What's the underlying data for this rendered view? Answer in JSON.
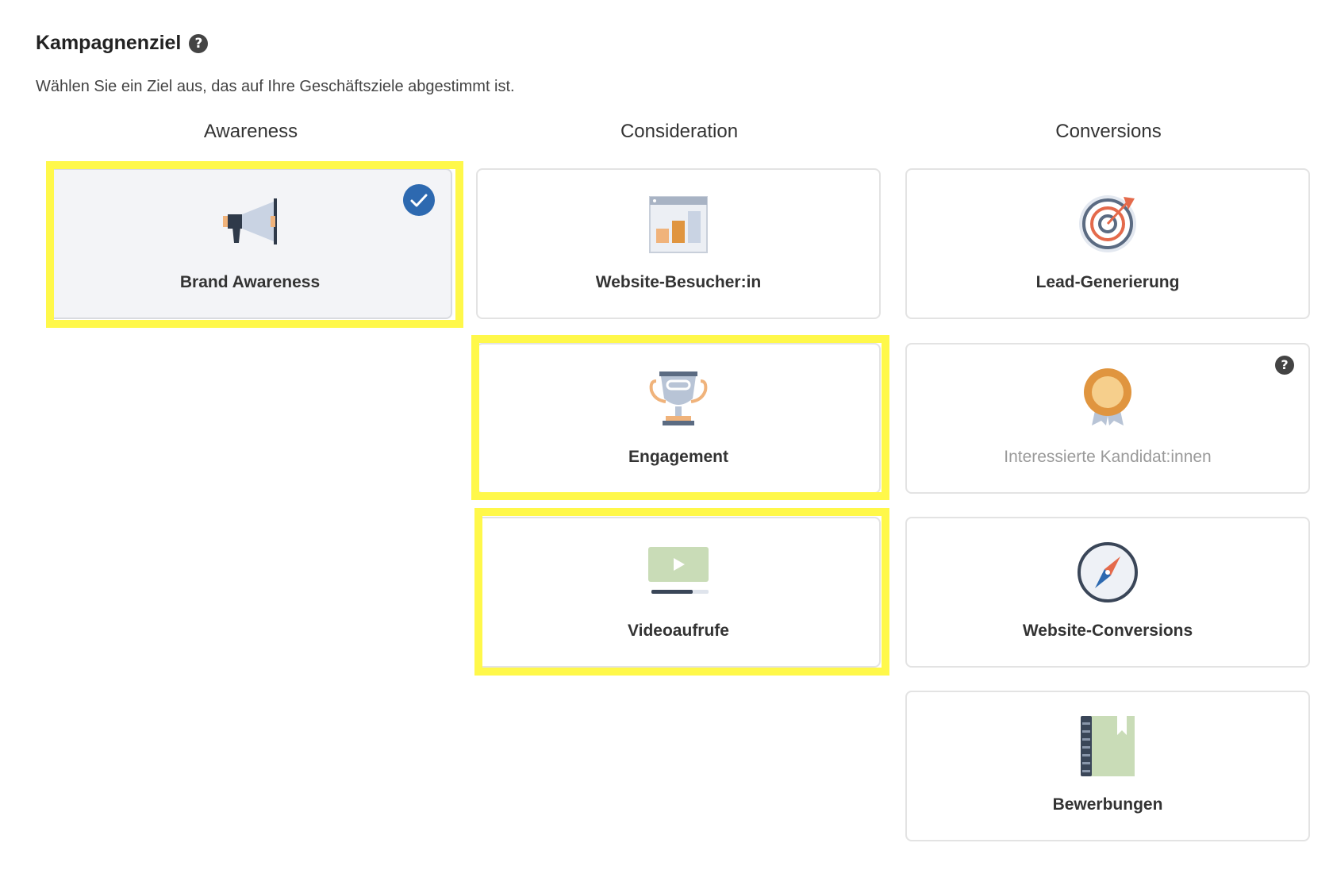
{
  "header": {
    "title": "Kampagnenziel",
    "title_help_icon": "question-circle-icon",
    "subtitle": "Wählen Sie ein Ziel aus, das auf Ihre Geschäftsziele abgestimmt ist."
  },
  "columns": {
    "awareness": "Awareness",
    "consideration": "Consideration",
    "conversions": "Conversions"
  },
  "cards": {
    "brand_awareness": {
      "label": "Brand Awareness",
      "icon": "megaphone-icon",
      "selected": true
    },
    "website_visitors": {
      "label": "Website-Besucher:in",
      "icon": "bar-chart-browser-icon"
    },
    "engagement": {
      "label": "Engagement",
      "icon": "trophy-icon"
    },
    "video_views": {
      "label": "Videoaufrufe",
      "icon": "video-play-icon"
    },
    "lead_generation": {
      "label": "Lead-Generierung",
      "icon": "target-icon"
    },
    "interested_candidates": {
      "label": "Interessierte Kandidat:innen",
      "icon": "award-badge-icon",
      "disabled": true
    },
    "website_conversions": {
      "label": "Website-Conversions",
      "icon": "compass-icon"
    },
    "applications": {
      "label": "Bewerbungen",
      "icon": "notebook-icon"
    }
  },
  "colors": {
    "highlight": "#fff84a",
    "check_accent": "#2d69b0",
    "selected_bg": "#f3f4f7"
  }
}
